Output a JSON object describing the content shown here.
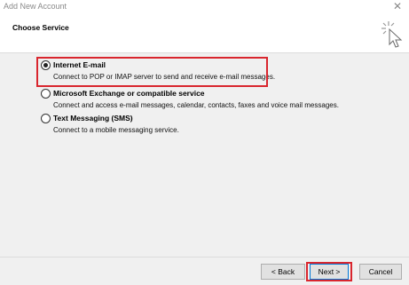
{
  "window": {
    "title": "Add New Account"
  },
  "header": {
    "title": "Choose Service",
    "icon": "wizard-cursor-icon"
  },
  "options": [
    {
      "label": "Internet E-mail",
      "description": "Connect to POP or IMAP server to send and receive e-mail messages.",
      "selected": true
    },
    {
      "label": "Microsoft Exchange or compatible service",
      "description": "Connect and access e-mail messages, calendar, contacts, faxes and voice mail messages.",
      "selected": false
    },
    {
      "label": "Text Messaging (SMS)",
      "description": "Connect to a mobile messaging service.",
      "selected": false
    }
  ],
  "buttons": {
    "back": "< Back",
    "next": "Next >",
    "cancel": "Cancel"
  },
  "colors": {
    "highlight": "#d9262e",
    "focus": "#0078d7"
  }
}
